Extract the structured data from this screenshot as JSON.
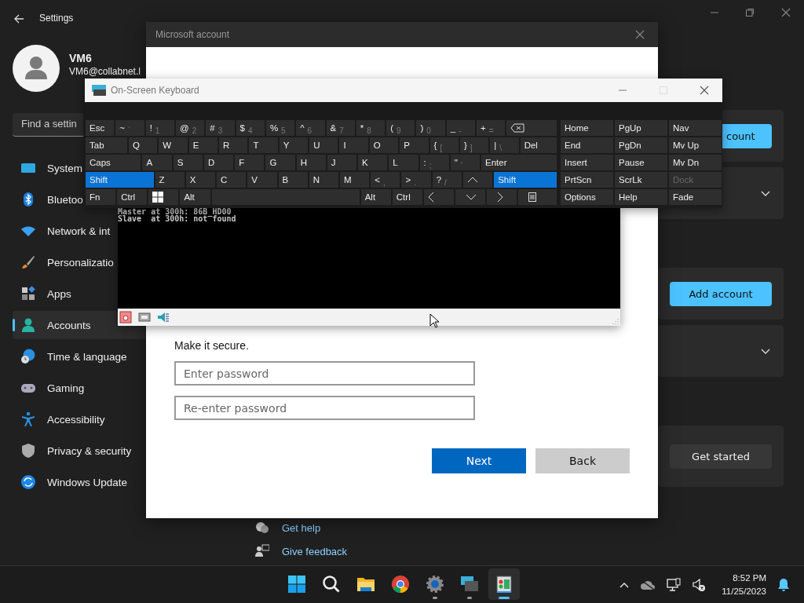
{
  "settings": {
    "title": "Settings",
    "profile": {
      "name": "VM6",
      "email": "VM6@collabnet.l"
    },
    "search": {
      "placeholder": "Find a settin"
    },
    "nav": [
      {
        "label": "System",
        "selected": false
      },
      {
        "label": "Bluetoo",
        "selected": false
      },
      {
        "label": "Network & int",
        "selected": false
      },
      {
        "label": "Personalizatio",
        "selected": false
      },
      {
        "label": "Apps",
        "selected": false
      },
      {
        "label": "Accounts",
        "selected": true
      },
      {
        "label": "Time & language",
        "selected": false
      },
      {
        "label": "Gaming",
        "selected": false
      },
      {
        "label": "Accessibility",
        "selected": false
      },
      {
        "label": "Privacy & security",
        "selected": false
      },
      {
        "label": "Windows Update",
        "selected": false
      }
    ],
    "cards": [
      {
        "kind": "button",
        "button": {
          "label": "count",
          "primary": true
        }
      },
      {
        "kind": "expander"
      },
      {
        "kind": "button",
        "button": {
          "label": "Add account",
          "primary": true
        }
      },
      {
        "kind": "expander"
      },
      {
        "kind": "button",
        "button": {
          "label": "Get started",
          "primary": false
        }
      }
    ],
    "links": [
      {
        "label": "Get help"
      },
      {
        "label": "Give feedback"
      }
    ]
  },
  "dialog": {
    "title": "Microsoft account",
    "prompt": "Make it secure.",
    "fields": [
      {
        "placeholder": "Enter password"
      },
      {
        "placeholder": "Re-enter password"
      }
    ],
    "buttons": [
      {
        "label": "Next",
        "primary": true
      },
      {
        "label": "Back",
        "primary": false
      }
    ]
  },
  "terminal": {
    "lines": [
      "Master at 300h: 86B_HD00",
      "Slave  at 300h: not found"
    ]
  },
  "keyboard": {
    "title": "On-Screen Keyboard",
    "rows": [
      [
        {
          "label": "Esc",
          "selected": false
        },
        {
          "label": "~",
          "sub": "`",
          "selected": false
        },
        {
          "label": "!",
          "sub": "1",
          "selected": false
        },
        {
          "label": "@",
          "sub": "2",
          "selected": false
        },
        {
          "label": "#",
          "sub": "3",
          "selected": false
        },
        {
          "label": "$",
          "sub": "4",
          "selected": false
        },
        {
          "label": "%",
          "sub": "5",
          "selected": false
        },
        {
          "label": "^",
          "sub": "6",
          "selected": false
        },
        {
          "label": "&",
          "sub": "7",
          "selected": false
        },
        {
          "label": "*",
          "sub": "8",
          "selected": false
        },
        {
          "label": "(",
          "sub": "9",
          "selected": false
        },
        {
          "label": ")",
          "sub": "0",
          "selected": false
        },
        {
          "label": "_",
          "sub": "-",
          "selected": false
        },
        {
          "label": "+",
          "sub": "=",
          "selected": false
        },
        {
          "kind": "backspace",
          "selected": false
        }
      ],
      [
        {
          "label": "Tab",
          "selected": false
        },
        {
          "label": "Q",
          "selected": false
        },
        {
          "label": "W",
          "selected": false
        },
        {
          "label": "E",
          "selected": false
        },
        {
          "label": "R",
          "selected": false
        },
        {
          "label": "T",
          "selected": false
        },
        {
          "label": "Y",
          "selected": false
        },
        {
          "label": "U",
          "selected": false
        },
        {
          "label": "I",
          "selected": false
        },
        {
          "label": "O",
          "selected": false
        },
        {
          "label": "P",
          "selected": false
        },
        {
          "label": "{",
          "sub": "[",
          "selected": false
        },
        {
          "label": "}",
          "sub": "]",
          "selected": false
        },
        {
          "label": "|",
          "sub": "\\",
          "selected": false
        },
        {
          "label": "Del",
          "selected": false
        }
      ],
      [
        {
          "label": "Caps",
          "selected": false
        },
        {
          "label": "A",
          "selected": false
        },
        {
          "label": "S",
          "selected": false
        },
        {
          "label": "D",
          "selected": false
        },
        {
          "label": "F",
          "selected": false
        },
        {
          "label": "G",
          "selected": false
        },
        {
          "label": "H",
          "selected": false
        },
        {
          "label": "J",
          "selected": false
        },
        {
          "label": "K",
          "selected": false
        },
        {
          "label": "L",
          "selected": false
        },
        {
          "label": ":",
          "sub": ";",
          "selected": false
        },
        {
          "label": "\"",
          "sub": "'",
          "selected": false
        },
        {
          "label": "Enter",
          "selected": false
        }
      ],
      [
        {
          "label": "Shift",
          "selected": true
        },
        {
          "label": "Z",
          "selected": false
        },
        {
          "label": "X",
          "selected": false
        },
        {
          "label": "C",
          "selected": false
        },
        {
          "label": "V",
          "selected": false
        },
        {
          "label": "B",
          "selected": false
        },
        {
          "label": "N",
          "selected": false
        },
        {
          "label": "M",
          "selected": false
        },
        {
          "label": "<",
          "sub": ",",
          "selected": false
        },
        {
          "label": ">",
          "sub": ".",
          "selected": false
        },
        {
          "label": "?",
          "sub": "/",
          "selected": false
        },
        {
          "kind": "up",
          "selected": false
        },
        {
          "label": "Shift",
          "selected": true
        }
      ],
      [
        {
          "label": "Fn",
          "selected": false
        },
        {
          "label": "Ctrl",
          "selected": false
        },
        {
          "kind": "windows",
          "selected": false
        },
        {
          "label": "Alt",
          "selected": false
        },
        {
          "kind": "space",
          "selected": false
        },
        {
          "label": "Alt",
          "selected": false
        },
        {
          "label": "Ctrl",
          "selected": false
        },
        {
          "kind": "left",
          "selected": false
        },
        {
          "kind": "down",
          "selected": false
        },
        {
          "kind": "right",
          "selected": false
        },
        {
          "kind": "menu",
          "selected": false
        }
      ]
    ],
    "side": [
      [
        {
          "label": "Home",
          "disabled": false
        },
        {
          "label": "PgUp",
          "disabled": false
        },
        {
          "label": "Nav",
          "disabled": false
        }
      ],
      [
        {
          "label": "End",
          "disabled": false
        },
        {
          "label": "PgDn",
          "disabled": false
        },
        {
          "label": "Mv Up",
          "disabled": false
        }
      ],
      [
        {
          "label": "Insert",
          "disabled": false
        },
        {
          "label": "Pause",
          "disabled": false
        },
        {
          "label": "Mv Dn",
          "disabled": false
        }
      ],
      [
        {
          "label": "PrtScn",
          "disabled": false
        },
        {
          "label": "ScrLk",
          "disabled": false
        },
        {
          "label": "Dock",
          "disabled": true
        }
      ],
      [
        {
          "label": "Options",
          "disabled": false
        },
        {
          "label": "Help",
          "disabled": false
        },
        {
          "label": "Fade",
          "disabled": false
        }
      ]
    ]
  },
  "taskbar": {
    "apps": [
      {
        "running": false,
        "selected": false
      },
      {
        "running": false,
        "selected": false
      },
      {
        "running": false,
        "selected": false
      },
      {
        "running": false,
        "selected": false
      },
      {
        "running": true,
        "selected": false
      },
      {
        "running": true,
        "selected": false
      },
      {
        "running": true,
        "selected": true
      }
    ],
    "time": "8:52 PM",
    "date": "11/25/2023"
  }
}
